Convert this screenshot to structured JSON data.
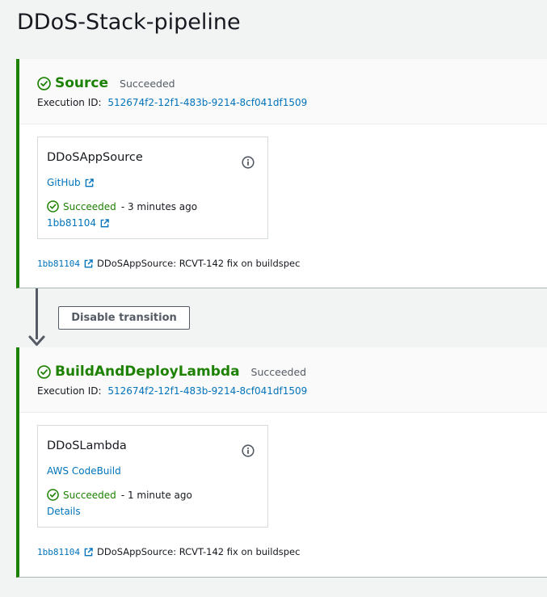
{
  "page": {
    "title": "DDoS-Stack-pipeline"
  },
  "colors": {
    "success": "#1d8102",
    "link": "#0073bb",
    "text": "#16191f",
    "muted": "#545b64"
  },
  "transition": {
    "button_label": "Disable transition"
  },
  "stages": [
    {
      "name": "Source",
      "status": "Succeeded",
      "execution_label": "Execution ID:",
      "execution_id": "512674f2-12f1-483b-9214-8cf041df1509",
      "action": {
        "name": "DDoSAppSource",
        "provider": "GitHub",
        "status": "Succeeded",
        "time": "- 3 minutes ago",
        "link": "1bb81104"
      },
      "commit": {
        "id": "1bb81104",
        "message": "DDoSAppSource: RCVT-142 fix on buildspec"
      }
    },
    {
      "name": "BuildAndDeployLambda",
      "status": "Succeeded",
      "execution_label": "Execution ID:",
      "execution_id": "512674f2-12f1-483b-9214-8cf041df1509",
      "action": {
        "name": "DDoSLambda",
        "provider": "AWS CodeBuild",
        "status": "Succeeded",
        "time": "- 1 minute ago",
        "link": "Details"
      },
      "commit": {
        "id": "1bb81104",
        "message": "DDoSAppSource: RCVT-142 fix on buildspec"
      }
    }
  ]
}
